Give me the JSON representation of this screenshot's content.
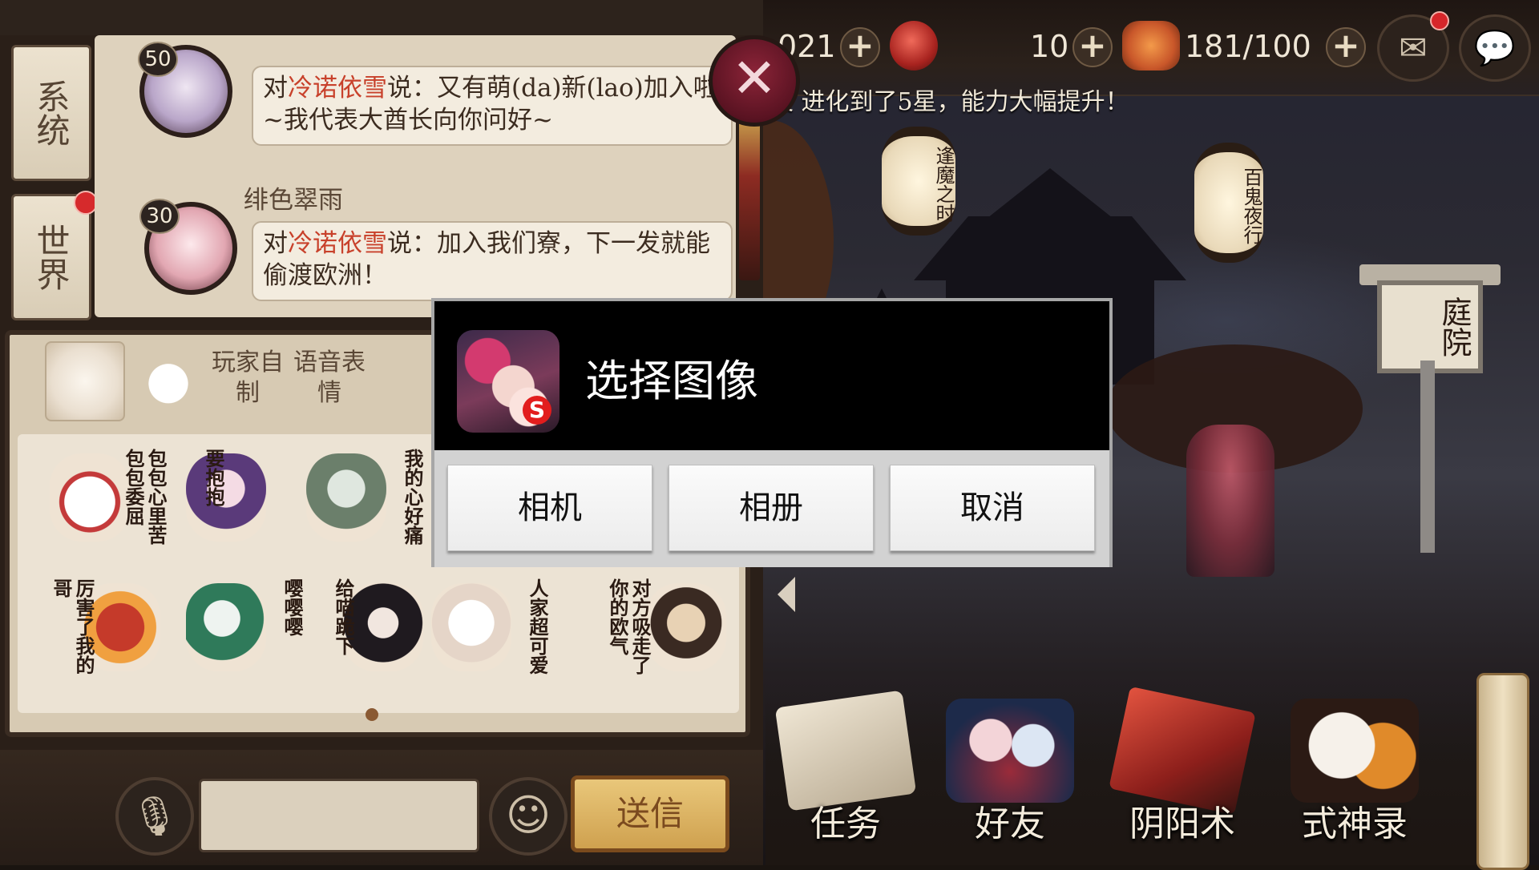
{
  "top_bar": {
    "jade_amount": "021",
    "ticket_amount": "10",
    "stamina": "181/100"
  },
  "news_ticker": "叉 进化到了5星，能力大幅提升！",
  "lanterns": [
    "逢魔之时",
    "百鬼夜行"
  ],
  "signboard": "庭院",
  "chat": {
    "tabs": [
      "系统",
      "世界"
    ],
    "messages": [
      {
        "level": "50",
        "sender": "",
        "prefix": "对",
        "target": "冷诺依雪",
        "text": "说：又有萌(da)新(lao)加入啦~我代表大酋长向你问好~"
      },
      {
        "level": "30",
        "sender": "绯色翠雨",
        "prefix": "对",
        "target": "冷诺依雪",
        "text": "说：加入我们寮，下一发就能偷渡欧洲！"
      }
    ],
    "emoji_tabs": [
      "玩家自制",
      "语音表情"
    ],
    "stickers": [
      "包包心里苦包包委屈",
      "要抱抱",
      "我的心好痛",
      "厉害了我的哥",
      "嘤嘤嘤",
      "给喵跪下",
      "人家超可爱",
      "对方吸走了你的欧气"
    ],
    "send_label": "送信"
  },
  "bottom_nav": [
    "任务",
    "好友",
    "阴阳术",
    "式神录"
  ],
  "dialog": {
    "title": "选择图像",
    "buttons": [
      "相机",
      "相册",
      "取消"
    ]
  },
  "colors": {
    "highlight_name": "#c8412b",
    "dialog_header": "#000000",
    "dialog_body": "#d2d2d2"
  }
}
